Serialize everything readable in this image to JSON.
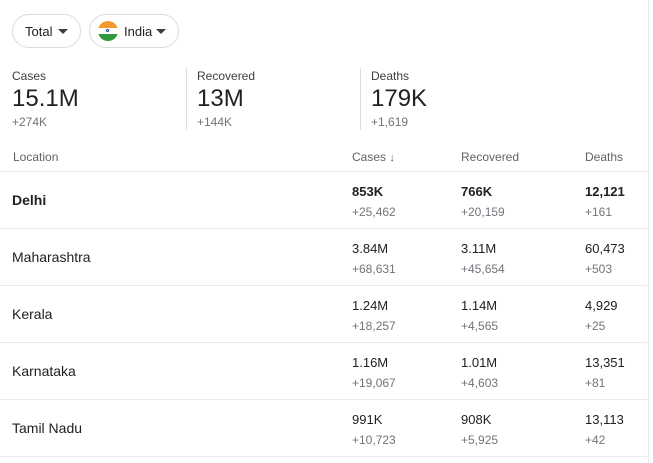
{
  "filters": {
    "type_label": "Total",
    "country_label": "India"
  },
  "summary": [
    {
      "label": "Cases",
      "value": "15.1M",
      "delta": "+274K"
    },
    {
      "label": "Recovered",
      "value": "13M",
      "delta": "+144K"
    },
    {
      "label": "Deaths",
      "value": "179K",
      "delta": "+1,619"
    }
  ],
  "table": {
    "headers": {
      "location": "Location",
      "cases": "Cases",
      "recovered": "Recovered",
      "deaths": "Deaths"
    },
    "sort_arrow": "↓",
    "rows": [
      {
        "location": "Delhi",
        "cases": "853K",
        "cases_delta": "+25,462",
        "recovered": "766K",
        "recovered_delta": "+20,159",
        "deaths": "12,121",
        "deaths_delta": "+161"
      },
      {
        "location": "Maharashtra",
        "cases": "3.84M",
        "cases_delta": "+68,631",
        "recovered": "3.11M",
        "recovered_delta": "+45,654",
        "deaths": "60,473",
        "deaths_delta": "+503"
      },
      {
        "location": "Kerala",
        "cases": "1.24M",
        "cases_delta": "+18,257",
        "recovered": "1.14M",
        "recovered_delta": "+4,565",
        "deaths": "4,929",
        "deaths_delta": "+25"
      },
      {
        "location": "Karnataka",
        "cases": "1.16M",
        "cases_delta": "+19,067",
        "recovered": "1.01M",
        "recovered_delta": "+4,603",
        "deaths": "13,351",
        "deaths_delta": "+81"
      },
      {
        "location": "Tamil Nadu",
        "cases": "991K",
        "cases_delta": "+10,723",
        "recovered": "908K",
        "recovered_delta": "+5,925",
        "deaths": "13,113",
        "deaths_delta": "+42"
      }
    ]
  }
}
